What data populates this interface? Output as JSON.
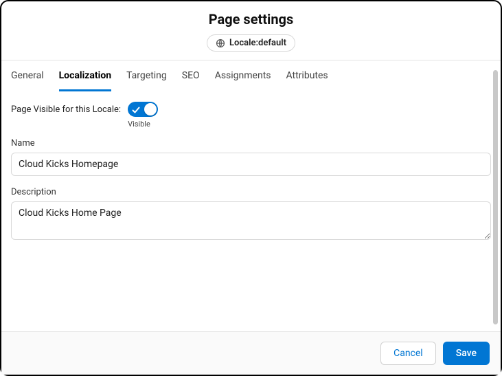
{
  "header": {
    "title": "Page settings",
    "locale_label": "Locale:default"
  },
  "tabs": [
    {
      "label": "General"
    },
    {
      "label": "Localization"
    },
    {
      "label": "Targeting"
    },
    {
      "label": "SEO"
    },
    {
      "label": "Assignments"
    },
    {
      "label": "Attributes"
    }
  ],
  "form": {
    "visibility_label": "Page Visible for this Locale:",
    "visibility_status": "Visible",
    "name_label": "Name",
    "name_value": "Cloud Kicks Homepage",
    "description_label": "Description",
    "description_value": "Cloud Kicks Home Page"
  },
  "footer": {
    "cancel": "Cancel",
    "save": "Save"
  }
}
